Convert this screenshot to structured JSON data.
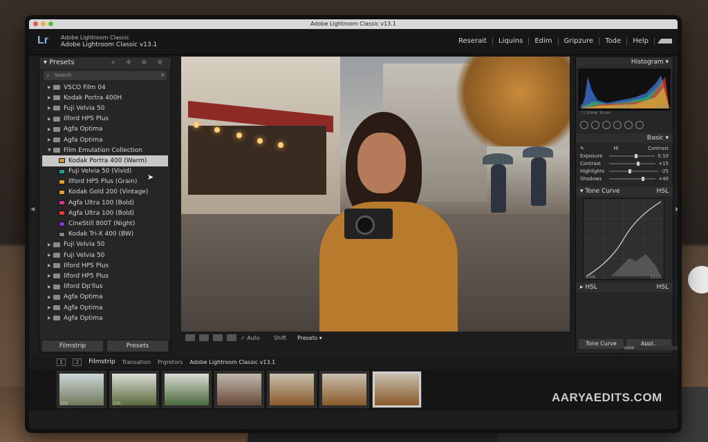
{
  "window": {
    "title": "Adobe Lightroom Classic v13.1"
  },
  "identity": {
    "logo": "Lr",
    "app_name_line1": "Adobe Lightroom Classic",
    "app_name_line2": "Adobe Lightroom Classic v13.1"
  },
  "modules": [
    "Reserait",
    "Liquins",
    "Edim",
    "Gripzure",
    "Tode",
    "Help"
  ],
  "left_panel": {
    "title": "Presets",
    "search_placeholder": "Search",
    "items": [
      {
        "label": "VSCO Film 04",
        "level": 0
      },
      {
        "label": "Kodak Portra 400H",
        "level": 0
      },
      {
        "label": "Fuji Velvia 50",
        "level": 0
      },
      {
        "label": "Ilford HPS Plus",
        "level": 0
      },
      {
        "label": "Agfa Optima",
        "level": 0
      },
      {
        "label": "Agfa Optima",
        "level": 0
      },
      {
        "label": "Film Emulation Collection",
        "level": 0,
        "expanded": true
      },
      {
        "label": "Kodak Portra 400 (Warm)",
        "level": 1,
        "color": "#c89b3a",
        "selected": true
      },
      {
        "label": "Fuji Velvia 50 (Vivid)",
        "level": 1,
        "color": "#2e9e8a"
      },
      {
        "label": "Ilford HP5 Plus (Grain)",
        "level": 1,
        "color": "#e0a030"
      },
      {
        "label": "Kodak Gold 200 (Vintage)",
        "level": 1,
        "color": "#e0a030"
      },
      {
        "label": "Agfa Ultra 100 (Bold)",
        "level": 1,
        "color": "#d03a8a"
      },
      {
        "label": "Agfa Ultra 100 (Bold)",
        "level": 1,
        "color": "#e04040"
      },
      {
        "label": "CineStill 800T (Night)",
        "level": 1,
        "color": "#7a3ad0"
      },
      {
        "label": "Kodak Tri-X 400 (BW)",
        "level": 1,
        "color": "#888888"
      },
      {
        "label": "Fuji Velvia 50",
        "level": 0
      },
      {
        "label": "Fuji Velvia 50",
        "level": 0
      },
      {
        "label": "Ilford HPS Plus",
        "level": 0
      },
      {
        "label": "Ilford HP5 Plus",
        "level": 0
      },
      {
        "label": "Ilford Dp'llus",
        "level": 0
      },
      {
        "label": "Agfa Optima",
        "level": 0
      },
      {
        "label": "Agfa Optima",
        "level": 0
      },
      {
        "label": "Agfa Optima",
        "level": 0
      }
    ],
    "bottom_buttons": [
      "Filmstrip",
      "Presets"
    ]
  },
  "toolbar": {
    "auto": "Auto",
    "shift": "Shift",
    "presets": "Presets"
  },
  "right_panel": {
    "histogram_title": "Histogram",
    "histo_axis": [
      "0/100",
      "10:00",
      "22:00"
    ],
    "show_tones": "Show Tones",
    "basic_title": "Basic",
    "hl_label": "Hl",
    "contrast_header": "Contrast",
    "sliders": [
      {
        "label": "Exposure",
        "value": "0.10",
        "pos": 0.55
      },
      {
        "label": "Contrast",
        "value": "+15",
        "pos": 0.6
      },
      {
        "label": "Highlights",
        "value": "-25",
        "pos": 0.4
      },
      {
        "label": "Shadows",
        "value": "+40",
        "pos": 0.7
      }
    ],
    "tone_curve_title": "Tone Curve",
    "hsl_title": "HSL",
    "curve_left_label": "€0l6",
    "curve_right_label": "1513",
    "hsl_left": "HSL",
    "hsl_right": "HSL",
    "buttons": [
      "Tone Curve",
      "Appl.."
    ]
  },
  "vote_label": "Vote",
  "filmstrip": {
    "tab_label": "Filmstrip",
    "crumbs": [
      "Transation",
      "Prgretors",
      "Adobe Lightroom Classic v13.1"
    ],
    "thumbs": [
      {
        "num": "200",
        "selected": false
      },
      {
        "num": "200",
        "selected": false
      },
      {
        "num": "",
        "selected": false
      },
      {
        "num": "",
        "selected": false
      },
      {
        "num": "",
        "selected": false
      },
      {
        "num": "",
        "selected": false
      },
      {
        "num": "",
        "selected": true
      }
    ]
  },
  "watermark": "AARYAEDITS.COM"
}
